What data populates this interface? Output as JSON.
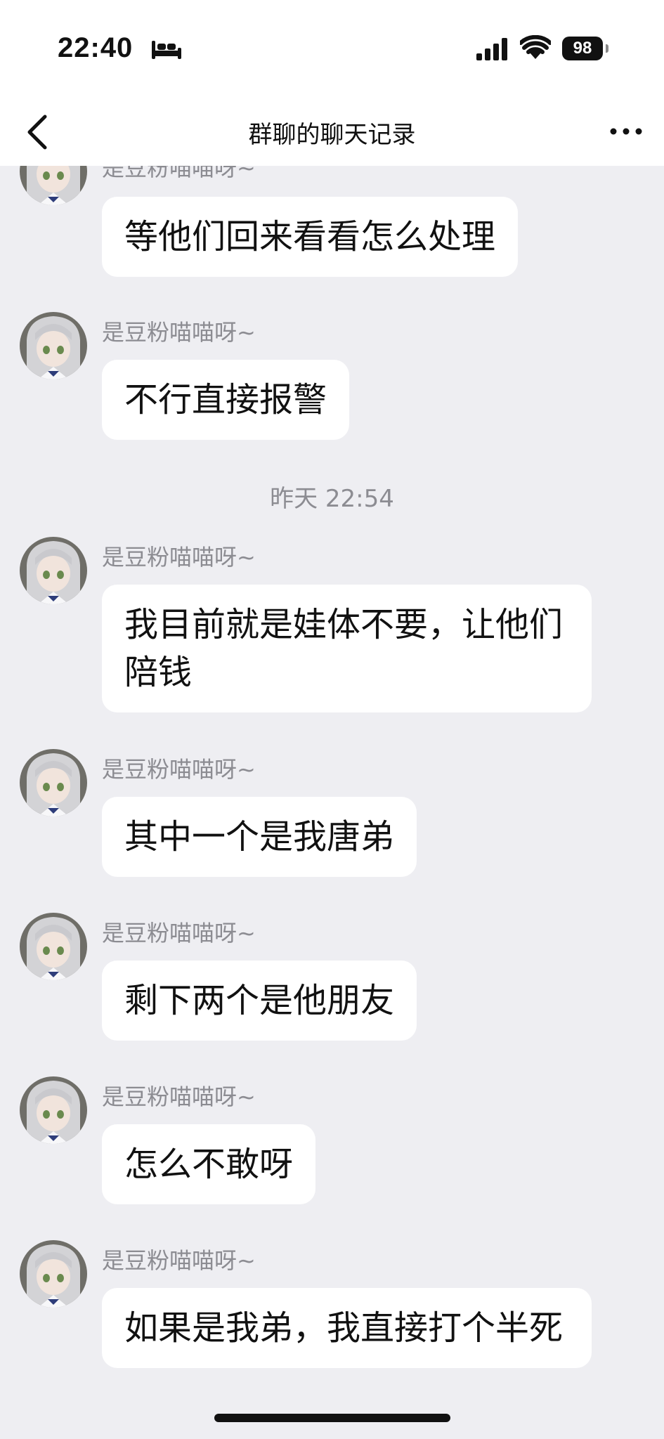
{
  "status_bar": {
    "time": "22:40",
    "battery": "98",
    "icons": [
      "bed-icon",
      "signal-icon",
      "wifi-icon",
      "battery-icon"
    ]
  },
  "nav": {
    "title": "群聊的聊天记录",
    "back_icon": "chevron-left-icon",
    "more_icon": "more-horizontal-icon"
  },
  "messages": [
    {
      "sender": "是豆粉喵喵呀~",
      "text": "等他们回来看看怎么处理"
    },
    {
      "sender": "是豆粉喵喵呀~",
      "text": "不行直接报警"
    },
    {
      "sender": "是豆粉喵喵呀~",
      "text": "我目前就是娃体不要，让他们陪钱"
    },
    {
      "sender": "是豆粉喵喵呀~",
      "text": "其中一个是我唐弟"
    },
    {
      "sender": "是豆粉喵喵呀~",
      "text": "剩下两个是他朋友"
    },
    {
      "sender": "是豆粉喵喵呀~",
      "text": "怎么不敢呀"
    },
    {
      "sender": "是豆粉喵喵呀~",
      "text": "如果是我弟，我直接打个半死"
    }
  ],
  "timestamp": "昨天 22:54",
  "colors": {
    "background": "#eeeef2",
    "bubble": "#ffffff",
    "secondary_text": "#8c8c92"
  }
}
